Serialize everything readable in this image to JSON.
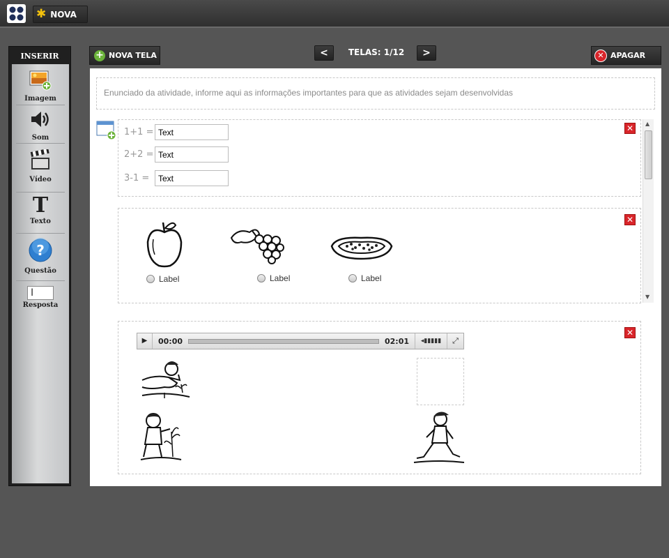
{
  "topbar": {
    "nova_label": "NOVA"
  },
  "sidebar": {
    "title": "INSERIR",
    "tools": [
      {
        "label": "Imagem",
        "icon": "image-add-icon"
      },
      {
        "label": "Som",
        "icon": "speaker-icon"
      },
      {
        "label": "Vídeo",
        "icon": "clapperboard-icon"
      },
      {
        "label": "Texto",
        "icon": "text-icon"
      },
      {
        "label": "Questão",
        "icon": "question-icon"
      },
      {
        "label": "Resposta",
        "icon": "text-cursor-icon"
      }
    ]
  },
  "header": {
    "nova_tela_label": "NOVA TELA",
    "prev_label": "<",
    "next_label": ">",
    "telas_label": "TELAS: 1/12",
    "apagar_label": "APAGAR"
  },
  "enunciado": "Enunciado da atividade, informe aqui as informações importantes para que as atividades sejam desenvolvidas",
  "math_block": {
    "rows": [
      {
        "equation": "1+1 =",
        "value": "Text"
      },
      {
        "equation": "2+2 =",
        "value": "Text"
      },
      {
        "equation": "3-1 =",
        "value": "Text"
      }
    ]
  },
  "fruit_block": {
    "options": [
      {
        "label": "Label",
        "image": "apple-drawing"
      },
      {
        "label": "Label",
        "image": "grapes-drawing"
      },
      {
        "label": "Label",
        "image": "papaya-drawing"
      }
    ]
  },
  "audio_block": {
    "current_time": "00:00",
    "duration": "02:01",
    "images": [
      "child-planting-drawing",
      "boy-watering-plant-drawing",
      "boy-walking-drawing"
    ]
  },
  "colors": {
    "accent_red": "#d9252a",
    "accent_green": "#6bb33a",
    "star_yellow": "#f4c20d"
  }
}
